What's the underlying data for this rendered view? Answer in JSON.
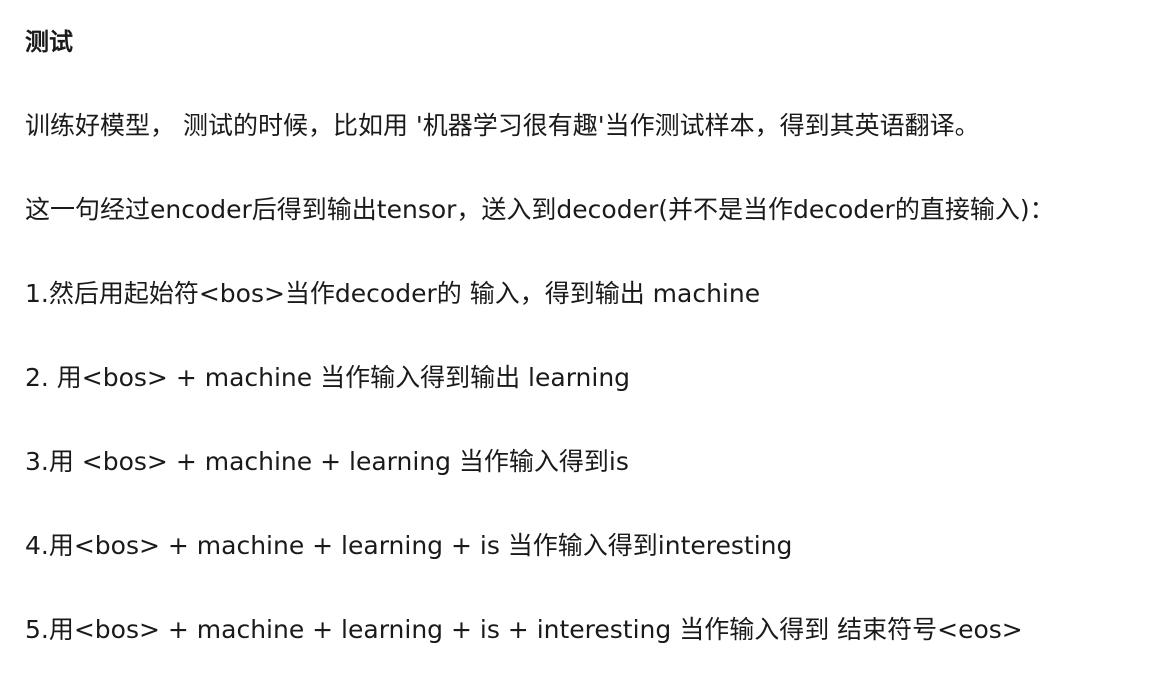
{
  "document": {
    "heading": "测试",
    "paragraphs": [
      "训练好模型， 测试的时候，比如用 '机器学习很有趣'当作测试样本，得到其英语翻译。",
      "这一句经过encoder后得到输出tensor，送入到decoder(并不是当作decoder的直接输入)：",
      "1.然后用起始符<bos>当作decoder的 输入，得到输出 machine",
      "2. 用<bos> + machine 当作输入得到输出 learning",
      "3.用 <bos> + machine + learning 当作输入得到is",
      "4.用<bos> + machine + learning + is 当作输入得到interesting",
      "5.用<bos> + machine + learning + is + interesting 当作输入得到 结束符号<eos>"
    ]
  }
}
